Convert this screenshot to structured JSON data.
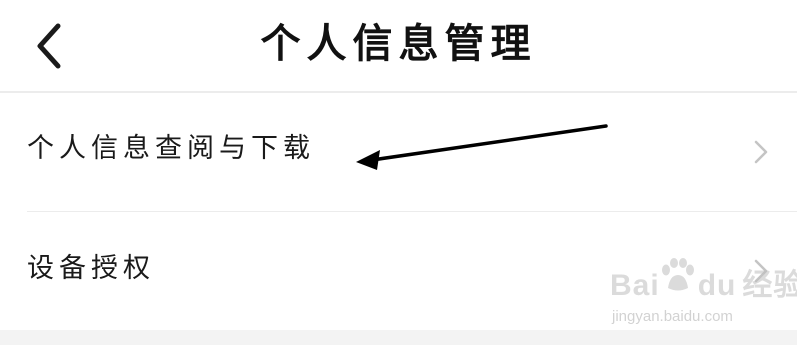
{
  "header": {
    "title": "个人信息管理",
    "back_icon": "chevron-left-icon"
  },
  "list": {
    "items": [
      {
        "label": "个人信息查阅与下载",
        "icon": "chevron-right-icon"
      },
      {
        "label": "设备授权",
        "icon": "chevron-right-icon"
      }
    ]
  },
  "watermark": {
    "brand_left": "Bai",
    "brand_right": "经验",
    "brand_mid": "du",
    "url": "jingyan.baidu.com"
  },
  "colors": {
    "background": "#ffffff",
    "text": "#1a1a1a",
    "divider": "#ececec",
    "chevron": "#c4c4c4",
    "arrow": "#000000"
  }
}
